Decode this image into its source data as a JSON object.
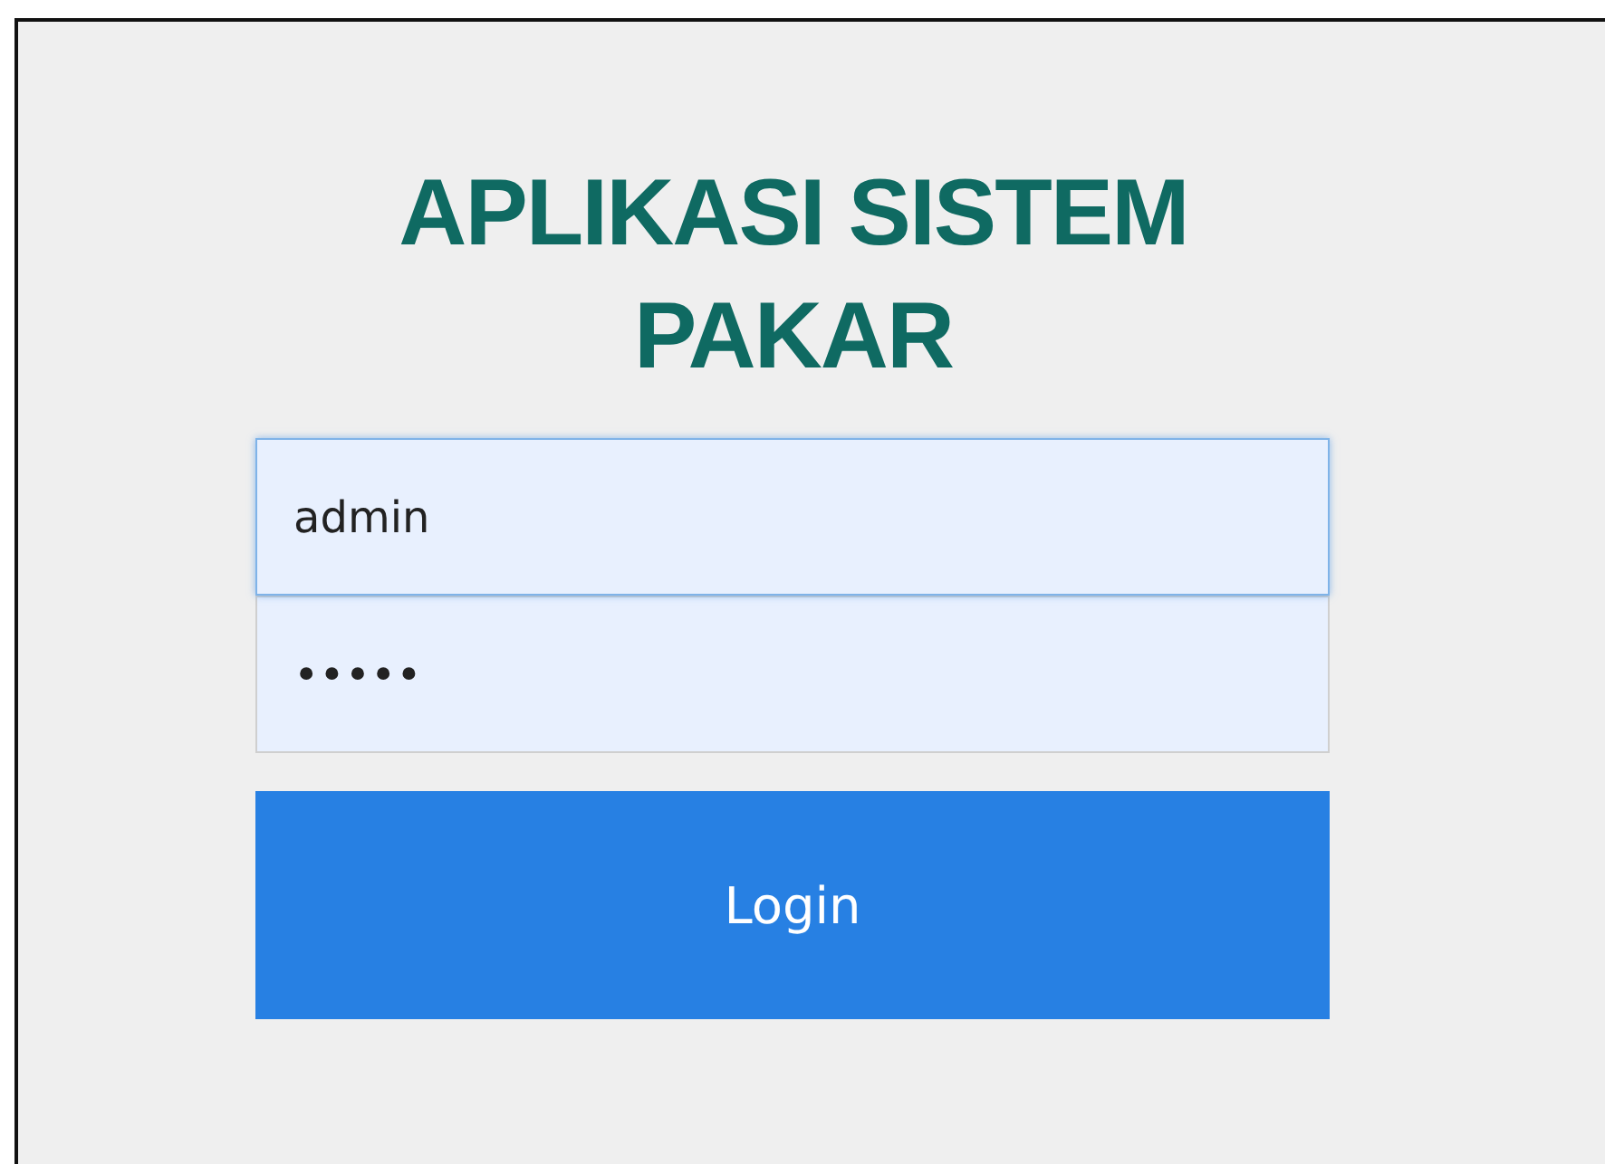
{
  "title": "APLIKASI SISTEM PAKAR",
  "fields": [
    {
      "value": "admin",
      "focused": true
    },
    {
      "value": "•••••",
      "focused": false
    }
  ],
  "button": {
    "label": "Login"
  }
}
